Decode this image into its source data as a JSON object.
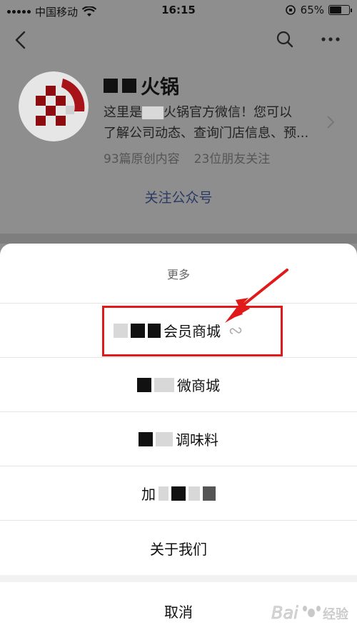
{
  "status_bar": {
    "carrier": "中国移动",
    "time": "16:15",
    "battery": "65%",
    "battery_level": 0.65
  },
  "nav": {
    "back_icon": "back-chevron-icon",
    "search_icon": "search-icon",
    "more_icon": "more-dots-icon"
  },
  "profile": {
    "name_visible": "火锅",
    "description_line1_prefix": "这里是",
    "description_line1_suffix": "火锅官方微信！您可以",
    "description_line2": "了解公司动态、查询门店信息、预...",
    "articles": "93篇原创内容",
    "followers": "23位朋友关注",
    "follow_label": "关注公众号"
  },
  "sheet": {
    "title": "更多",
    "items": [
      {
        "label": "会员商城"
      },
      {
        "label": "微商城"
      },
      {
        "label": "调味料"
      },
      {
        "label": "加"
      },
      {
        "label": "关于我们"
      }
    ],
    "cancel": "取消"
  },
  "colors": {
    "highlight": "#e01a1a",
    "accent_link": "#2b3a64"
  },
  "watermark": "Bai经验"
}
